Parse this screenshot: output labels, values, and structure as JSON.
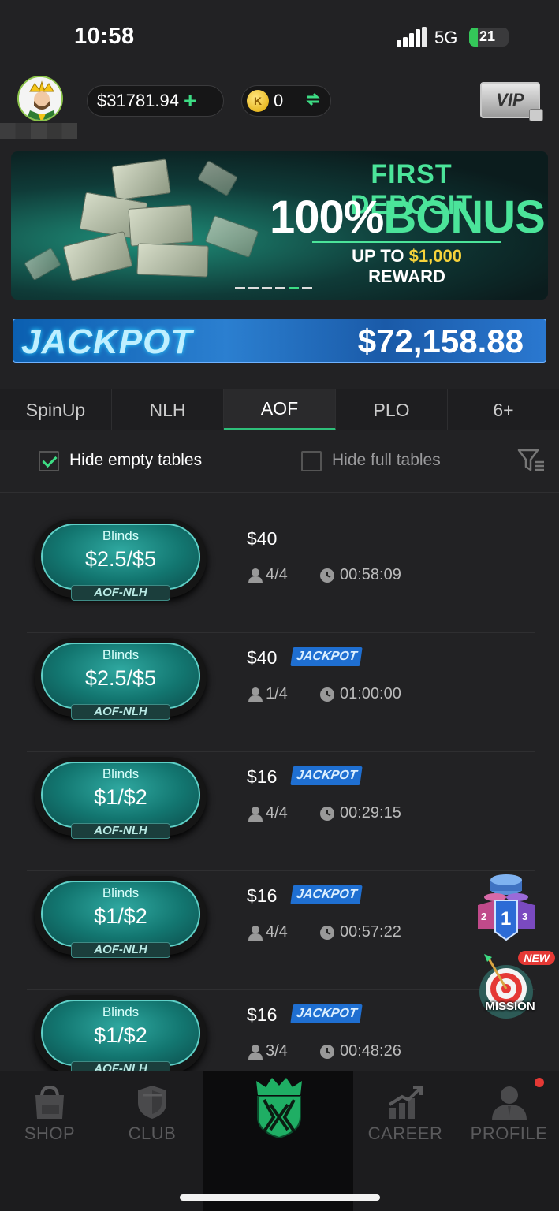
{
  "status_bar": {
    "time": "10:58",
    "network": "5G",
    "battery": "21",
    "battery_level": 0.21
  },
  "header": {
    "balance": "$31781.94",
    "balance_add_icon": "plus-icon",
    "coins": "0",
    "coin_symbol": "K",
    "vip_label": "VIP"
  },
  "banner": {
    "line1": "FIRST DEPOSIT",
    "line2_white": "100%",
    "line2_green": "BONUS",
    "sub_prefix": "UP TO ",
    "sub_amount": "$1,000",
    "sub_suffix": " REWARD",
    "slide_count": 6,
    "active_slide": 5
  },
  "jackpot": {
    "label": "JACKPOT",
    "value": "$72,158.88"
  },
  "tabs": [
    {
      "label": "SpinUp",
      "active": false
    },
    {
      "label": "NLH",
      "active": false
    },
    {
      "label": "AOF",
      "active": true
    },
    {
      "label": "PLO",
      "active": false
    },
    {
      "label": "6+",
      "active": false
    }
  ],
  "filters": {
    "hide_empty": {
      "label": "Hide empty tables",
      "checked": true
    },
    "hide_full": {
      "label": "Hide full tables",
      "checked": false
    }
  },
  "tables": [
    {
      "blinds_label": "Blinds",
      "blinds": "$2.5/$5",
      "type": "AOF-NLH",
      "buyin": "$40",
      "jackpot": false,
      "players": "4/4",
      "time": "00:58:09"
    },
    {
      "blinds_label": "Blinds",
      "blinds": "$2.5/$5",
      "type": "AOF-NLH",
      "buyin": "$40",
      "jackpot": true,
      "jackpot_label": "JACKPOT",
      "players": "1/4",
      "time": "01:00:00"
    },
    {
      "blinds_label": "Blinds",
      "blinds": "$1/$2",
      "type": "AOF-NLH",
      "buyin": "$16",
      "jackpot": true,
      "jackpot_label": "JACKPOT",
      "players": "4/4",
      "time": "00:29:15"
    },
    {
      "blinds_label": "Blinds",
      "blinds": "$1/$2",
      "type": "AOF-NLH",
      "buyin": "$16",
      "jackpot": true,
      "jackpot_label": "JACKPOT",
      "players": "4/4",
      "time": "00:57:22"
    },
    {
      "blinds_label": "Blinds",
      "blinds": "$1/$2",
      "type": "AOF-NLH",
      "buyin": "$16",
      "jackpot": true,
      "jackpot_label": "JACKPOT",
      "players": "3/4",
      "time": "00:48:26"
    }
  ],
  "floating": {
    "rank_numbers": [
      "2",
      "1",
      "3"
    ],
    "mission_label": "MISSION",
    "mission_badge": "NEW"
  },
  "nav": {
    "shop": "SHOP",
    "club": "CLUB",
    "career": "CAREER",
    "profile": "PROFILE"
  },
  "colors": {
    "accent_green": "#3ddc84",
    "jackpot_blue": "#1f6fd1",
    "table_teal": "#137771",
    "background": "#222224"
  }
}
